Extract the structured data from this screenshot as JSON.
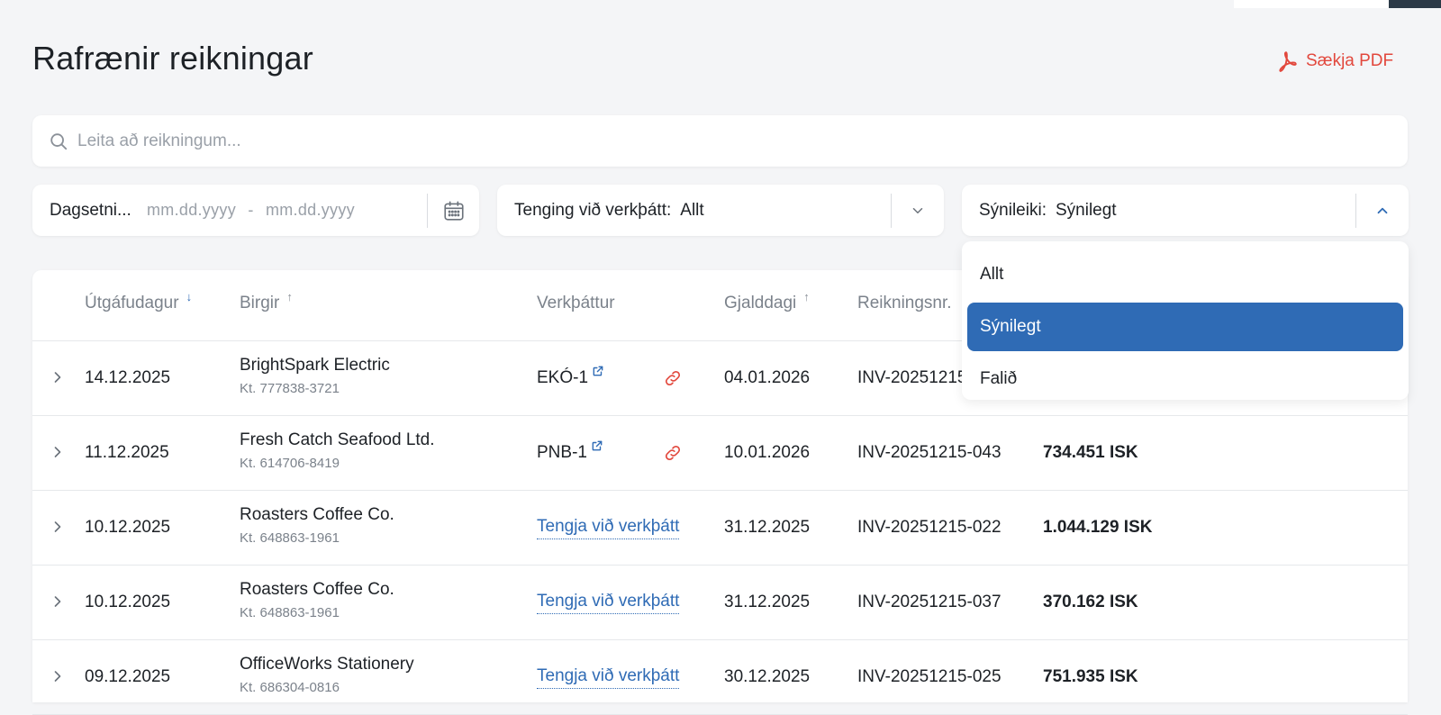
{
  "page": {
    "title": "Rafrænir reikningar",
    "pdf_label": "Sækja PDF"
  },
  "search": {
    "placeholder": "Leita að reikningum..."
  },
  "filters": {
    "date": {
      "label": "Dagsetni...",
      "from_placeholder": "mm.dd.yyyy",
      "separator": "-",
      "to_placeholder": "mm.dd.yyyy"
    },
    "task": {
      "label": "Tenging við verkþátt:",
      "value": "Allt"
    },
    "visibility": {
      "label": "Sýnileiki:",
      "value": "Sýnilegt",
      "options": [
        "Allt",
        "Sýnilegt",
        "Falið"
      ],
      "selected_index": 1
    }
  },
  "table": {
    "columns": {
      "issue_date": "Útgáfudagur",
      "supplier": "Birgir",
      "task": "Verkþáttur",
      "due_date": "Gjalddagi",
      "invoice_no": "Reikningsnr."
    },
    "link_task_label": "Tengja við verkþátt",
    "rows": [
      {
        "issue_date": "14.12.2025",
        "supplier": "BrightSpark Electric",
        "kt": "Kt. 777838-3721",
        "task": "EKÓ-1",
        "due_date": "04.01.2026",
        "invoice_no": "INV-20251215",
        "amount": ""
      },
      {
        "issue_date": "11.12.2025",
        "supplier": "Fresh Catch Seafood Ltd.",
        "kt": "Kt. 614706-8419",
        "task": "PNB-1",
        "due_date": "10.01.2026",
        "invoice_no": "INV-20251215-043",
        "amount": "734.451 ISK"
      },
      {
        "issue_date": "10.12.2025",
        "supplier": "Roasters Coffee Co.",
        "kt": "Kt. 648863-1961",
        "task": "",
        "due_date": "31.12.2025",
        "invoice_no": "INV-20251215-022",
        "amount": "1.044.129 ISK"
      },
      {
        "issue_date": "10.12.2025",
        "supplier": "Roasters Coffee Co.",
        "kt": "Kt. 648863-1961",
        "task": "",
        "due_date": "31.12.2025",
        "invoice_no": "INV-20251215-037",
        "amount": "370.162 ISK"
      },
      {
        "issue_date": "09.12.2025",
        "supplier": "OfficeWorks Stationery",
        "kt": "Kt. 686304-0816",
        "task": "",
        "due_date": "30.12.2025",
        "invoice_no": "INV-20251215-025",
        "amount": "751.935 ISK"
      }
    ]
  },
  "colors": {
    "accent": "#2f6bb5",
    "pdf_red": "#e2483d",
    "background": "#f4f5f7"
  }
}
